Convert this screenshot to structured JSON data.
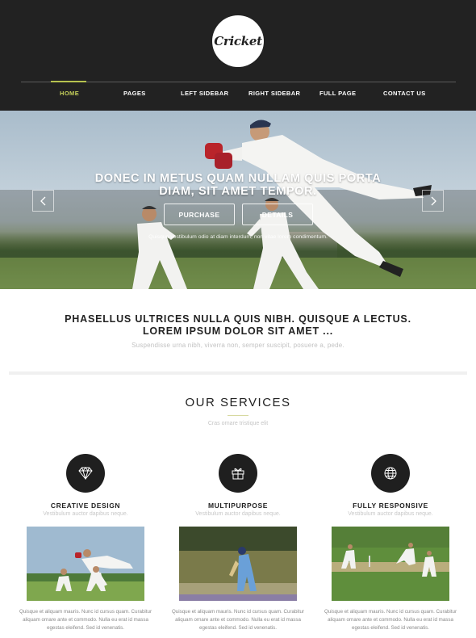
{
  "header": {
    "logo_text": "Cricket",
    "nav": [
      {
        "label": "HOME",
        "active": true
      },
      {
        "label": "PAGES",
        "active": false
      },
      {
        "label": "LEFT SIDEBAR",
        "active": false
      },
      {
        "label": "RIGHT SIDEBAR",
        "active": false
      },
      {
        "label": "FULL PAGE",
        "active": false
      },
      {
        "label": "CONTACT US",
        "active": false
      }
    ]
  },
  "hero": {
    "title_line1": "DONEC IN METUS QUAM NULLAM QUIS PORTA",
    "title_line2": "DIAM, SIT AMET TEMPOR.",
    "purchase_label": "PURCHASE",
    "details_label": "DETAILS",
    "caption": "Quisque vestibulum odio at diam interdum, non vitae lorem condimentum.",
    "prev_icon": "chevron-left-icon",
    "next_icon": "chevron-right-icon"
  },
  "intro": {
    "heading_line1": "PHASELLUS ULTRICES NULLA QUIS NIBH. QUISQUE A LECTUS.",
    "heading_line2": "LOREM IPSUM DOLOR SIT AMET ...",
    "subtext": "Suspendisse urna nibh, viverra non, semper suscipit, posuere a, pede."
  },
  "services": {
    "title": "OUR SERVICES",
    "subtitle": "Cras ornare tristique elit",
    "items": [
      {
        "icon": "diamond-icon",
        "title": "CREATIVE DESIGN",
        "subtitle": "Vestibulum auctor dapibus neque.",
        "text_line1": "Quisque et aliquam mauris. Nunc id cursus quam. Curabitur",
        "text_line2": "aliquam ornare ante et commodo. Nulla eu erat id massa",
        "text_line3": "egestas eleifend. Sed id venenatis."
      },
      {
        "icon": "gift-icon",
        "title": "MULTIPURPOSE",
        "subtitle": "Vestibulum auctor dapibus neque.",
        "text_line1": "Quisque et aliquam mauris. Nunc id cursus quam. Curabitur",
        "text_line2": "aliquam ornare ante et commodo. Nulla eu erat id massa",
        "text_line3": "egestas eleifend. Sed id venenatis."
      },
      {
        "icon": "globe-icon",
        "title": "FULLY RESPONSIVE",
        "subtitle": "Vestibulum auctor dapibus neque.",
        "text_line1": "Quisque et aliquam mauris. Nunc id cursus quam. Curabitur",
        "text_line2": "aliquam ornare ante et commodo. Nulla eu erat id massa",
        "text_line3": "egestas eleifend. Sed id venenatis."
      }
    ]
  },
  "colors": {
    "header_bg": "#222222",
    "accent": "#c5cf5a",
    "icon_circle": "#1f1f1f"
  }
}
